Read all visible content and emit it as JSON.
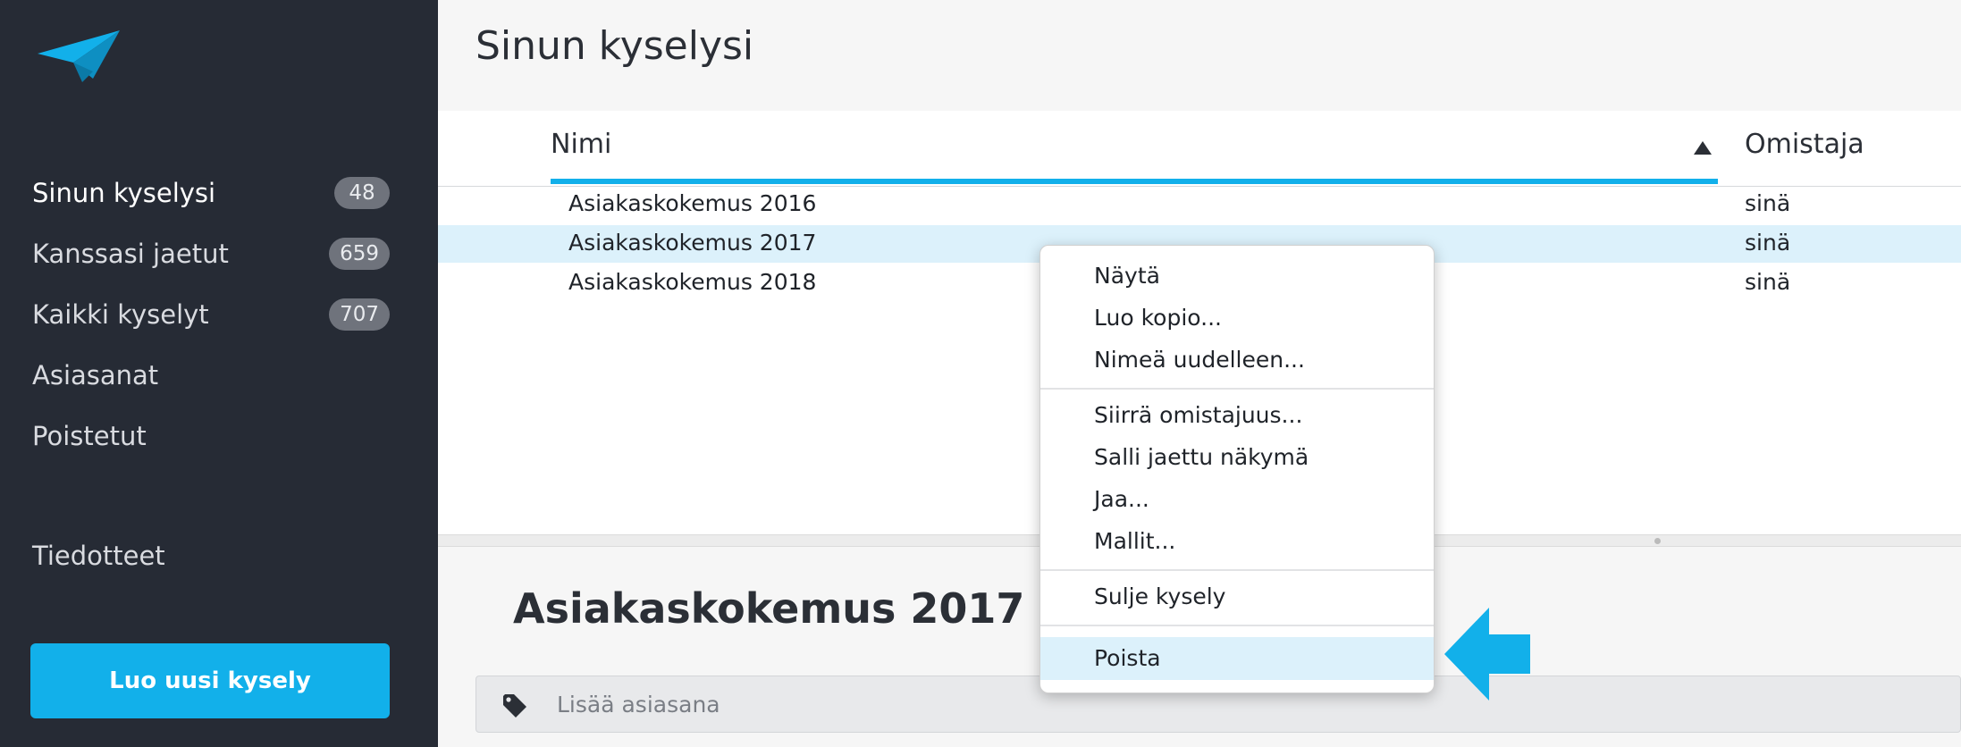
{
  "sidebar": {
    "items": [
      {
        "label": "Sinun kyselysi",
        "count": "48"
      },
      {
        "label": "Kanssasi jaetut",
        "count": "659"
      },
      {
        "label": "Kaikki kyselyt",
        "count": "707"
      },
      {
        "label": "Asiasanat"
      },
      {
        "label": "Poistetut"
      },
      {
        "label": "Tiedotteet"
      }
    ],
    "create_button": "Luo uusi kysely"
  },
  "main": {
    "title": "Sinun kyselysi",
    "columns": {
      "name": "Nimi",
      "owner": "Omistaja"
    },
    "rows": [
      {
        "name": "Asiakaskokemus 2016",
        "owner": "sinä"
      },
      {
        "name": "Asiakaskokemus 2017",
        "owner": "sinä"
      },
      {
        "name": "Asiakaskokemus 2018",
        "owner": "sinä"
      }
    ]
  },
  "detail": {
    "title": "Asiakaskokemus 2017",
    "tag_placeholder": "Lisää asiasana"
  },
  "context_menu": {
    "items": [
      "Näytä",
      "Luo kopio...",
      "Nimeä uudelleen...",
      "Siirrä omistajuus...",
      "Salli jaettu näkymä",
      "Jaa...",
      "Mallit...",
      "Sulje kysely",
      "Poista"
    ]
  },
  "colors": {
    "accent": "#12b0ea",
    "sidebar_bg": "#262b35",
    "selection": "#dcf1fb"
  }
}
